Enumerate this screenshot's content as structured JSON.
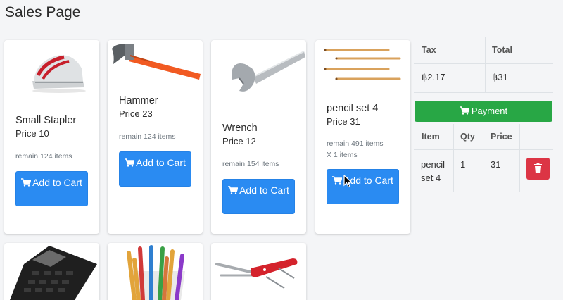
{
  "page": {
    "title": "Sales Page"
  },
  "products": [
    {
      "name": "Small Stapler",
      "price": "Price 10",
      "remain": "remain 124 items",
      "qty_line": "",
      "button": "Add to Cart",
      "image_icon": "stapler-image"
    },
    {
      "name": "Hammer",
      "price": "Price 23",
      "remain": "remain 124 items",
      "qty_line": "",
      "button": "Add to Cart",
      "image_icon": "hammer-image"
    },
    {
      "name": "Wrench",
      "price": "Price 12",
      "remain": "remain 154 items",
      "qty_line": "",
      "button": "Add to Cart",
      "image_icon": "wrench-image"
    },
    {
      "name": "pencil set 4",
      "price": "Price 31",
      "remain": "remain 491 items",
      "qty_line": "X 1 items",
      "button": "Add to Cart",
      "image_icon": "pencils-image"
    },
    {
      "image_icon": "calculator-image"
    },
    {
      "image_icon": "colored-pencils-image"
    },
    {
      "image_icon": "swiss-knife-image"
    }
  ],
  "summary": {
    "headers": {
      "tax": "Tax",
      "total": "Total"
    },
    "tax": "฿2.17",
    "total": "฿31"
  },
  "payment_button": "Payment",
  "cart": {
    "headers": {
      "item": "Item",
      "qty": "Qty",
      "price": "Price"
    },
    "rows": [
      {
        "item": "pencil set 4",
        "qty": "1",
        "price": "31"
      }
    ]
  },
  "colors": {
    "primary": "#2a8bf2",
    "success": "#28a745",
    "danger": "#dc3545"
  }
}
